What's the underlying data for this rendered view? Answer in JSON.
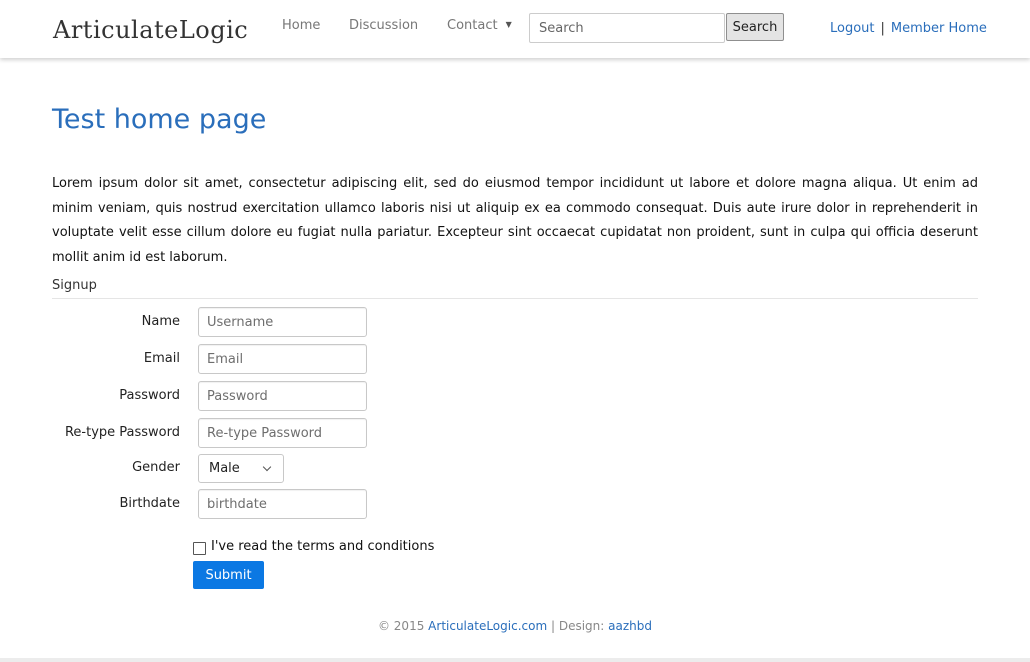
{
  "header": {
    "brand": "ArticulateLogic",
    "nav": [
      "Home",
      "Discussion",
      "Contact"
    ],
    "search_placeholder": "Search",
    "search_button": "Search",
    "logout": "Logout",
    "separator": "|",
    "member_home": "Member Home"
  },
  "main": {
    "title": "Test home page",
    "intro": "Lorem ipsum dolor sit amet, consectetur adipiscing elit, sed do eiusmod tempor incididunt ut labore et dolore magna aliqua. Ut enim ad minim veniam, quis nostrud exercitation ullamco laboris nisi ut aliquip ex ea commodo consequat. Duis aute irure dolor in reprehenderit in voluptate velit esse cillum dolore eu fugiat nulla pariatur. Excepteur sint occaecat cupidatat non proident, sunt in culpa qui officia deserunt mollit anim id est laborum."
  },
  "form": {
    "legend": "Signup",
    "fields": [
      {
        "label": "Name",
        "placeholder": "Username"
      },
      {
        "label": "Email",
        "placeholder": "Email"
      },
      {
        "label": "Password",
        "placeholder": "Password"
      },
      {
        "label": "Re-type Password",
        "placeholder": "Re-type Password"
      },
      {
        "label": "Birthdate",
        "placeholder": "birthdate"
      }
    ],
    "gender": {
      "label": "Gender",
      "selected": "Male"
    },
    "terms_checked": false,
    "terms_label": "I've read the terms and conditions",
    "submit": "Submit"
  },
  "footer": {
    "copyright": "© 2015",
    "site": "ArticulateLogic.com",
    "design_prefix": "| Design:",
    "designer": "aazhbd"
  }
}
